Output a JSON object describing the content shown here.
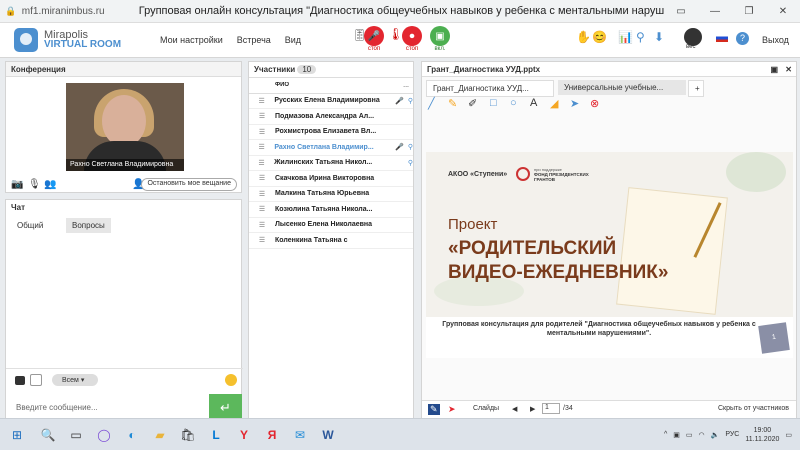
{
  "browser": {
    "url": "mf1.miranimbus.ru",
    "title": "Групповая онлайн консультация \"Диагностика общеучебных навыков у ребенка с ментальными нарушениям..."
  },
  "app": {
    "logo_line1": "Mirapolis",
    "logo_line2": "VIRTUAL ROOM",
    "menu": [
      "Мои настройки",
      "Встреча",
      "Вид"
    ],
    "stop1": "стоп",
    "stop2": "стоп",
    "on": "вкл.",
    "exit": "Выход",
    "ves": "вес"
  },
  "conference": {
    "title": "Конференция",
    "name": "Рахно Светлана   Владимировна",
    "stop_button": "Остановить мое вещание"
  },
  "chat": {
    "title": "Чат",
    "tab_general": "Общий",
    "tab_questions": "Вопросы",
    "audience": "Всем",
    "placeholder": "Введите сообщение..."
  },
  "participants": {
    "title": "Участники",
    "count": "10",
    "col": "ФИО",
    "more": "...",
    "list": [
      "Русских Елена Владимировна",
      "Подмазова  Александра Ал...",
      "Рохмистрова  Елизавета Вл...",
      "Рахно Светлана  Владимир...",
      "Жилинских  Татьяна  Никол...",
      "Скачкова Ирина Викторовна",
      "Малкина Татьяна  Юрьевна",
      "Козюлина  Татьяна Никола...",
      "Лысенко Елена Николаевна",
      "Коленкина  Татьяна  с"
    ]
  },
  "doc": {
    "title": "Грант_Диагностика УУД.pptx",
    "tab1": "Грант_Диагностика УУД...",
    "tab2": "Универсальные учебные...",
    "add": "+",
    "slides_label": "Слайды",
    "page": "1",
    "total": "/34",
    "hide": "Скрыть от участников",
    "thumb": "1"
  },
  "slide": {
    "org": "АКОО «Ступени»",
    "fund": "ФОНД ПРЕЗИДЕНТСКИХ ГРАНТОВ",
    "fund_pre": "при поддержке",
    "l1": "Проект",
    "l2": "«РОДИТЕЛЬСКИЙ",
    "l3": "ВИДЕО-ЕЖЕДНЕВНИК»",
    "caption": "Групповая консультация для родителей \"Диагностика общеучебных навыков у ребенка с ментальными нарушениями\"."
  },
  "taskbar": {
    "lang": "РУС",
    "time": "19:00",
    "date": "11.11.2020"
  },
  "colors": {
    "accent": "#4c8fcf",
    "red": "#e3262f",
    "green": "#5cb85c",
    "send": "#5cb85c"
  }
}
